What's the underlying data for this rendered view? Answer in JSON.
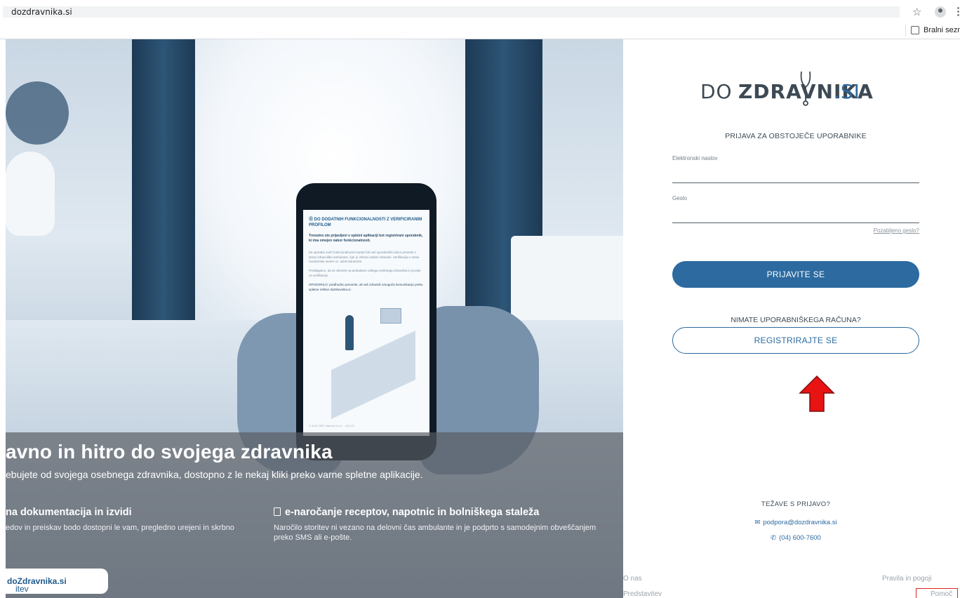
{
  "browser": {
    "address": "dozdravnika.si",
    "bookmarks_label": "Bralni seznam"
  },
  "hero": {
    "phone_screen": {
      "heading": "⓪ DO DODATNIH FUNKCIONALNOSTI Z VERIFICIRANIM PROFILOM",
      "subheading": "Trenutno ste prijavljeni v spletni aplikaciji kot registrirani uporabnik, ki ima omejen nabor funkcionalnosti.",
      "para1": "Za uporabo vseh funkcionalnosti morate biti vaš uporabniški račun preveriti s strani zdravniške ambulante, kjer je izbrani osebni zdravnik. Verifikacija s strani medicinske sestre oz. administratorke.",
      "para2": "Predlagamo, da se obrnete na ambulanto vašega osebnega zdravnika in prosite za verifikacijo.",
      "para3": "OPOZORILO: predhodno preverite, ali vaš zdravnik omogoča komunikacijo preko spletne rešitve doZdravnika.si.",
      "footer": "© 2021 SRC Internet d.o.o. - v3.4.21"
    },
    "title": "avno in hitro do svojega zdravnika",
    "subtitle": "ebujete od svojega osebnega zdravnika, dostopno z le nekaj kliki preko varne spletne aplikacije.",
    "features": [
      {
        "title": "na dokumentacija in izvidi",
        "text": "edov in preiskav bodo dostopni le vam, pregledno urejeni in skrbno"
      },
      {
        "title": "e-naročanje receptov, napotnic in bolniškega staleža",
        "text": "Naročilo storitev ni vezano na delovni čas ambulante in je podprto s samodejnim obveščanjem preko SMS ali e-pošte."
      }
    ],
    "cta_prefix": "itev ",
    "cta_brand": "doZdravnika.si"
  },
  "logo": {
    "do": "DO",
    "main": "ZDRAVNIKA",
    "si": ".SI"
  },
  "login": {
    "heading": "PRIJAVA ZA OBSTOJEČE UPORABNIKE",
    "email_label": "Elektronski naslov",
    "email_value": "",
    "password_label": "Geslo",
    "password_value": "",
    "forgot": "Pozabljeno geslo?",
    "submit": "PRIJAVITE SE",
    "no_account": "NIMATE UPORABNIŠKEGA RAČUNA?",
    "register": "REGISTRIRAJTE SE"
  },
  "support": {
    "title": "TEŽAVE S PRIJAVO?",
    "email": "podpora@dozdravnika.si",
    "phone": "(04) 600-7600"
  },
  "footer": {
    "about": "O nas",
    "presentation": "Predstavitev",
    "terms": "Pravila in pogoji",
    "help": "Pomoč"
  },
  "colors": {
    "brand": "#2c6aa0",
    "annotation_arrow": "#e81313",
    "annotation_box": "#e02424"
  }
}
